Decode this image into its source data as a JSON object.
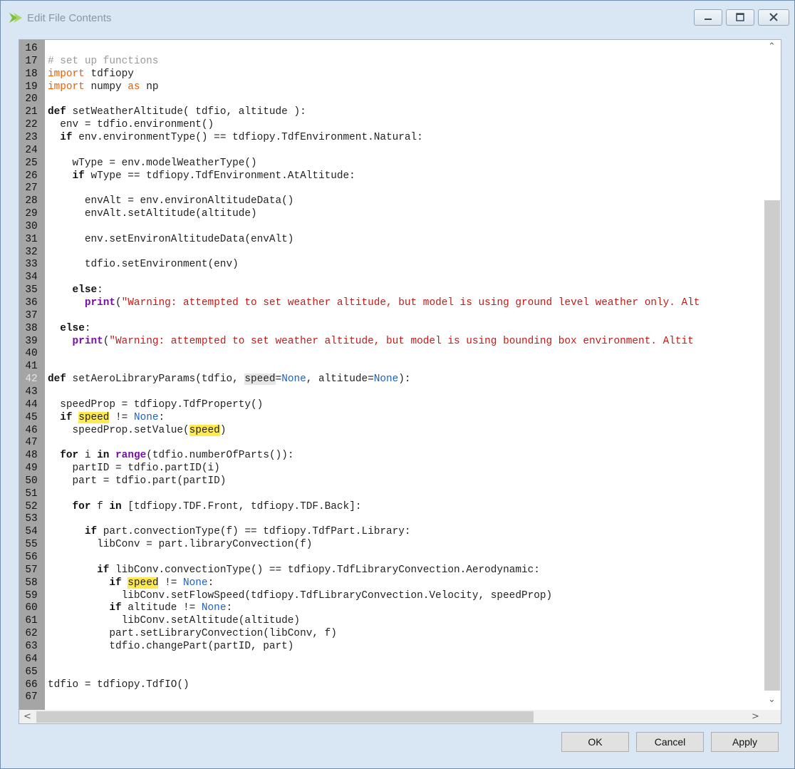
{
  "window": {
    "title": "Edit File Contents",
    "buttons": {
      "minimize_glyph": "—",
      "maximize_glyph": "□",
      "close_glyph": "✕"
    }
  },
  "editor": {
    "current_line": 42,
    "lines": [
      {
        "n": "16",
        "html": ""
      },
      {
        "n": "17",
        "html": "<span class=\"com\"># set up functions</span>"
      },
      {
        "n": "18",
        "html": "<span class=\"kn\">import</span> tdfiopy"
      },
      {
        "n": "19",
        "html": "<span class=\"kn\">import</span> numpy <span class=\"kn\">as</span> np"
      },
      {
        "n": "20",
        "html": ""
      },
      {
        "n": "21",
        "html": "<span class=\"kwb\">def</span> setWeatherAltitude( tdfio, altitude ):"
      },
      {
        "n": "22",
        "html": "  env = tdfio.environment()"
      },
      {
        "n": "23",
        "html": "  <span class=\"kwb\">if</span> env.environmentType() == tdfiopy.TdfEnvironment.Natural:"
      },
      {
        "n": "24",
        "html": ""
      },
      {
        "n": "25",
        "html": "    wType = env.modelWeatherType()"
      },
      {
        "n": "26",
        "html": "    <span class=\"kwb\">if</span> wType == tdfiopy.TdfEnvironment.AtAltitude:"
      },
      {
        "n": "27",
        "html": ""
      },
      {
        "n": "28",
        "html": "      envAlt = env.environAltitudeData()"
      },
      {
        "n": "29",
        "html": "      envAlt.setAltitude(altitude)"
      },
      {
        "n": "30",
        "html": ""
      },
      {
        "n": "31",
        "html": "      env.setEnvironAltitudeData(envAlt)"
      },
      {
        "n": "32",
        "html": ""
      },
      {
        "n": "33",
        "html": "      tdfio.setEnvironment(env)"
      },
      {
        "n": "34",
        "html": ""
      },
      {
        "n": "35",
        "html": "    <span class=\"kwb\">else</span>:"
      },
      {
        "n": "36",
        "html": "      <span class=\"fn\">print</span>(<span class=\"str\">\"Warning: attempted to set weather altitude, but model is using ground level weather only. Alt</span>"
      },
      {
        "n": "37",
        "html": ""
      },
      {
        "n": "38",
        "html": "  <span class=\"kwb\">else</span>:"
      },
      {
        "n": "39",
        "html": "    <span class=\"fn\">print</span>(<span class=\"str\">\"Warning: attempted to set weather altitude, but model is using bounding box environment. Altit</span>"
      },
      {
        "n": "40",
        "html": ""
      },
      {
        "n": "41",
        "html": ""
      },
      {
        "n": "42",
        "html": "<span class=\"kwb\">def</span> setAeroLibraryParams(tdfio, <span class=\"sel\">speed</span>=<span class=\"none\">None</span>, altitude=<span class=\"none\">None</span>):"
      },
      {
        "n": "43",
        "html": ""
      },
      {
        "n": "44",
        "html": "  speedProp = tdfiopy.TdfProperty()"
      },
      {
        "n": "45",
        "html": "  <span class=\"kwb\">if</span> <span class=\"hl\">speed</span> != <span class=\"none\">None</span>:"
      },
      {
        "n": "46",
        "html": "    speedProp.setValue(<span class=\"hl\">speed</span>)"
      },
      {
        "n": "47",
        "html": ""
      },
      {
        "n": "48",
        "html": "  <span class=\"kwb\">for</span> i <span class=\"kwb\">in</span> <span class=\"fn\">range</span>(tdfio.numberOfParts()):"
      },
      {
        "n": "49",
        "html": "    partID = tdfio.partID(i)"
      },
      {
        "n": "50",
        "html": "    part = tdfio.part(partID)"
      },
      {
        "n": "51",
        "html": ""
      },
      {
        "n": "52",
        "html": "    <span class=\"kwb\">for</span> f <span class=\"kwb\">in</span> [tdfiopy.TDF.Front, tdfiopy.TDF.Back]:"
      },
      {
        "n": "53",
        "html": ""
      },
      {
        "n": "54",
        "html": "      <span class=\"kwb\">if</span> part.convectionType(f) == tdfiopy.TdfPart.Library:"
      },
      {
        "n": "55",
        "html": "        libConv = part.libraryConvection(f)"
      },
      {
        "n": "56",
        "html": ""
      },
      {
        "n": "57",
        "html": "        <span class=\"kwb\">if</span> libConv.convectionType() == tdfiopy.TdfLibraryConvection.Aerodynamic:"
      },
      {
        "n": "58",
        "html": "          <span class=\"kwb\">if</span> <span class=\"hl\">speed</span> != <span class=\"none\">None</span>:"
      },
      {
        "n": "59",
        "html": "            libConv.setFlowSpeed(tdfiopy.TdfLibraryConvection.Velocity, speedProp)"
      },
      {
        "n": "60",
        "html": "          <span class=\"kwb\">if</span> altitude != <span class=\"none\">None</span>:"
      },
      {
        "n": "61",
        "html": "            libConv.setAltitude(altitude)"
      },
      {
        "n": "62",
        "html": "          part.setLibraryConvection(libConv, f)"
      },
      {
        "n": "63",
        "html": "          tdfio.changePart(partID, part)"
      },
      {
        "n": "64",
        "html": ""
      },
      {
        "n": "65",
        "html": ""
      },
      {
        "n": "66",
        "html": "tdfio = tdfiopy.TdfIO()"
      },
      {
        "n": "67",
        "html": ""
      }
    ]
  },
  "scrollbars": {
    "up": "⌃",
    "down": "⌄",
    "left": "<",
    "right": ">"
  },
  "footer": {
    "ok_label": "OK",
    "cancel_label": "Cancel",
    "apply_label": "Apply"
  },
  "colors": {
    "keyword": "#e36209",
    "string": "#c41a16",
    "comment": "#9a9a9a",
    "none": "#1f5fbf",
    "builtin": "#7a0da8",
    "highlight": "#ffe94d"
  }
}
